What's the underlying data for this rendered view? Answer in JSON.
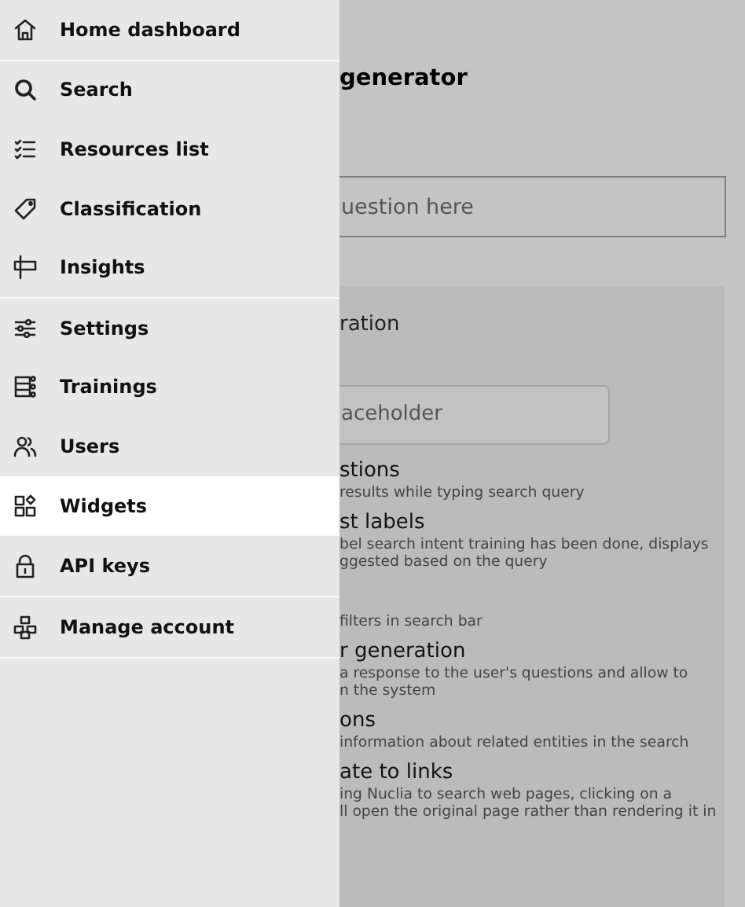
{
  "sidebar": {
    "groups": [
      [
        {
          "label": "Home dashboard",
          "selected": false
        }
      ],
      [
        {
          "label": "Search",
          "selected": false
        },
        {
          "label": "Resources list",
          "selected": false
        },
        {
          "label": "Classification",
          "selected": false
        },
        {
          "label": "Insights",
          "selected": false
        }
      ],
      [
        {
          "label": "Settings",
          "selected": false
        },
        {
          "label": "Trainings",
          "selected": false
        },
        {
          "label": "Users",
          "selected": false
        },
        {
          "label": "Widgets",
          "selected": true
        }
      ],
      [
        {
          "label": "API keys",
          "selected": false
        }
      ],
      [
        {
          "label": "Manage account",
          "selected": false
        }
      ]
    ]
  },
  "main": {
    "title": "generator",
    "question_field": {
      "placeholder": "uestion here"
    },
    "panel": {
      "heading": "ration",
      "field": {
        "placeholder": "aceholder"
      },
      "options": [
        {
          "title": "stions",
          "description": [
            "results while typing search query"
          ]
        },
        {
          "title": "st labels",
          "description": [
            "bel search intent training has been done, displays",
            "ggested based on the query"
          ]
        },
        {
          "description": [
            "filters in search bar"
          ]
        },
        {
          "title": "r generation",
          "description": [
            "a response to the user's questions and allow to",
            "n the system"
          ]
        },
        {
          "title": "ons",
          "description": [
            "information about related entities in the search"
          ]
        },
        {
          "title": "ate to links",
          "description": [
            "ing Nuclia to search web pages, clicking on a",
            "ll open the original page rather than rendering it in"
          ]
        }
      ]
    }
  }
}
